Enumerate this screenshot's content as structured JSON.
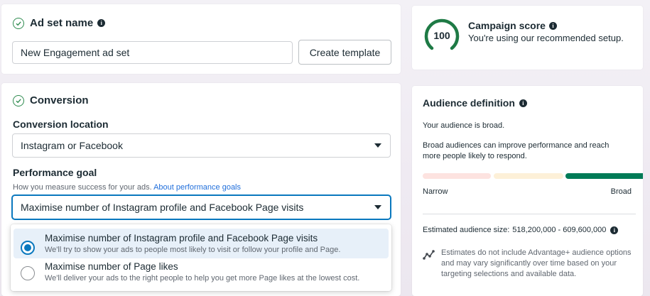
{
  "ad_set": {
    "heading": "Ad set name",
    "name_value": "New Engagement ad set",
    "create_template_label": "Create template"
  },
  "conversion": {
    "heading": "Conversion",
    "location_label": "Conversion location",
    "location_value": "Instagram or Facebook",
    "goal_label": "Performance goal",
    "goal_help": "How you measure success for your ads.",
    "goal_help_link": "About performance goals",
    "goal_value": "Maximise number of Instagram profile and Facebook Page visits"
  },
  "goal_options": [
    {
      "title": "Maximise number of Instagram profile and Facebook Page visits",
      "description": "We'll try to show your ads to people most likely to visit or follow your profile and Page.",
      "selected": true
    },
    {
      "title": "Maximise number of Page likes",
      "description": "We'll deliver your ads to the right people to help you get more Page likes at the lowest cost.",
      "selected": false
    }
  ],
  "campaign_score": {
    "score": "100",
    "title": "Campaign score",
    "subtitle": "You're using our recommended setup."
  },
  "audience": {
    "heading": "Audience definition",
    "status": "Your audience is broad.",
    "advice": "Broad audiences can improve performance and reach more people likely to respond.",
    "narrow_label": "Narrow",
    "broad_label": "Broad",
    "size_label": "Estimated audience size:",
    "size_value": "518,200,000 - 609,600,000",
    "estimate_note": "Estimates do not include Advantage+ audience options and may vary significantly over time based on your targeting selections and available data."
  },
  "colors": {
    "accent_green": "#007b57",
    "score_ring": "#1e7a45",
    "meter_red": "#fde3e0",
    "meter_yellow": "#fdf0d8",
    "radio_blue": "#0a78be",
    "link_blue": "#216fdb",
    "selected_option_bg": "#e7f0f9"
  },
  "icons": {
    "ad_set_check": "check-circle-icon",
    "conversion_check": "check-circle-icon",
    "info": "info-icon",
    "dropdown": "caret-down-icon",
    "estimate": "trend-line-icon"
  }
}
